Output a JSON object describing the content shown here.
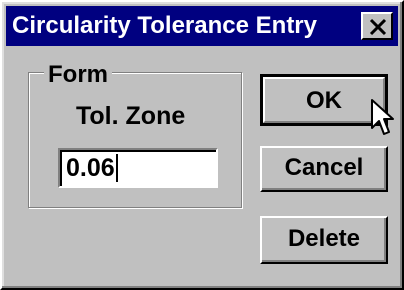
{
  "window": {
    "title": "Circularity Tolerance Entry",
    "close_icon": "close-icon"
  },
  "form_group": {
    "label": "Form",
    "field_label": "Tol. Zone",
    "tol_zone_value": "0.06"
  },
  "buttons": {
    "ok": "OK",
    "cancel": "Cancel",
    "delete": "Delete"
  },
  "colors": {
    "titlebar": "#000080",
    "face": "#c0c0c0"
  }
}
